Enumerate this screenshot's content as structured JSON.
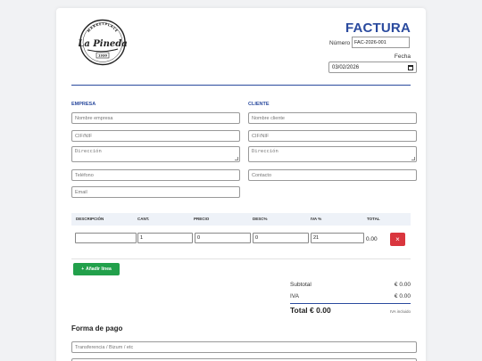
{
  "invoice": {
    "title": "FACTURA",
    "number_label": "Número",
    "number_value": "FAC-2026-001",
    "date_label": "Fecha",
    "date_value": "03/02/2026"
  },
  "logo": {
    "top_text": "MARKETPLACE",
    "name": "La Pineda",
    "year": "1930"
  },
  "empresa": {
    "section_label": "EMPRESA",
    "name_placeholder": "Nombre empresa",
    "cif_placeholder": "CIF/NIF",
    "address_placeholder": "Dirección",
    "phone_placeholder": "Teléfono",
    "email_placeholder": "Email"
  },
  "cliente": {
    "section_label": "CLIENTE",
    "name_placeholder": "Nombre cliente",
    "cif_placeholder": "CIF/NIF",
    "address_placeholder": "Dirección",
    "contact_placeholder": "Contacto"
  },
  "table": {
    "headers": [
      "DESCRIPCIÓN",
      "CANT.",
      "PRECIO",
      "DESC%",
      "IVA %",
      "TOTAL"
    ],
    "rows": [
      {
        "description": "",
        "qty": "1",
        "price": "0",
        "discount": "0",
        "vat": "21",
        "total": "0.00"
      }
    ],
    "delete_symbol": "×"
  },
  "add_line": {
    "icon": "+",
    "label": "Añadir línea"
  },
  "totals": {
    "subtotal_label": "Subtotal",
    "subtotal_value": "€ 0.00",
    "vat_label": "IVA",
    "vat_value": "€ 0.00",
    "total_label": "Total € 0.00",
    "vat_note": "IVA incluido"
  },
  "payment": {
    "title": "Forma de pago",
    "placeholder": "Transferencia / Bizum / etc"
  },
  "colors": {
    "accent": "#2a4a9e",
    "delete": "#d9363e",
    "add": "#22a04b"
  }
}
